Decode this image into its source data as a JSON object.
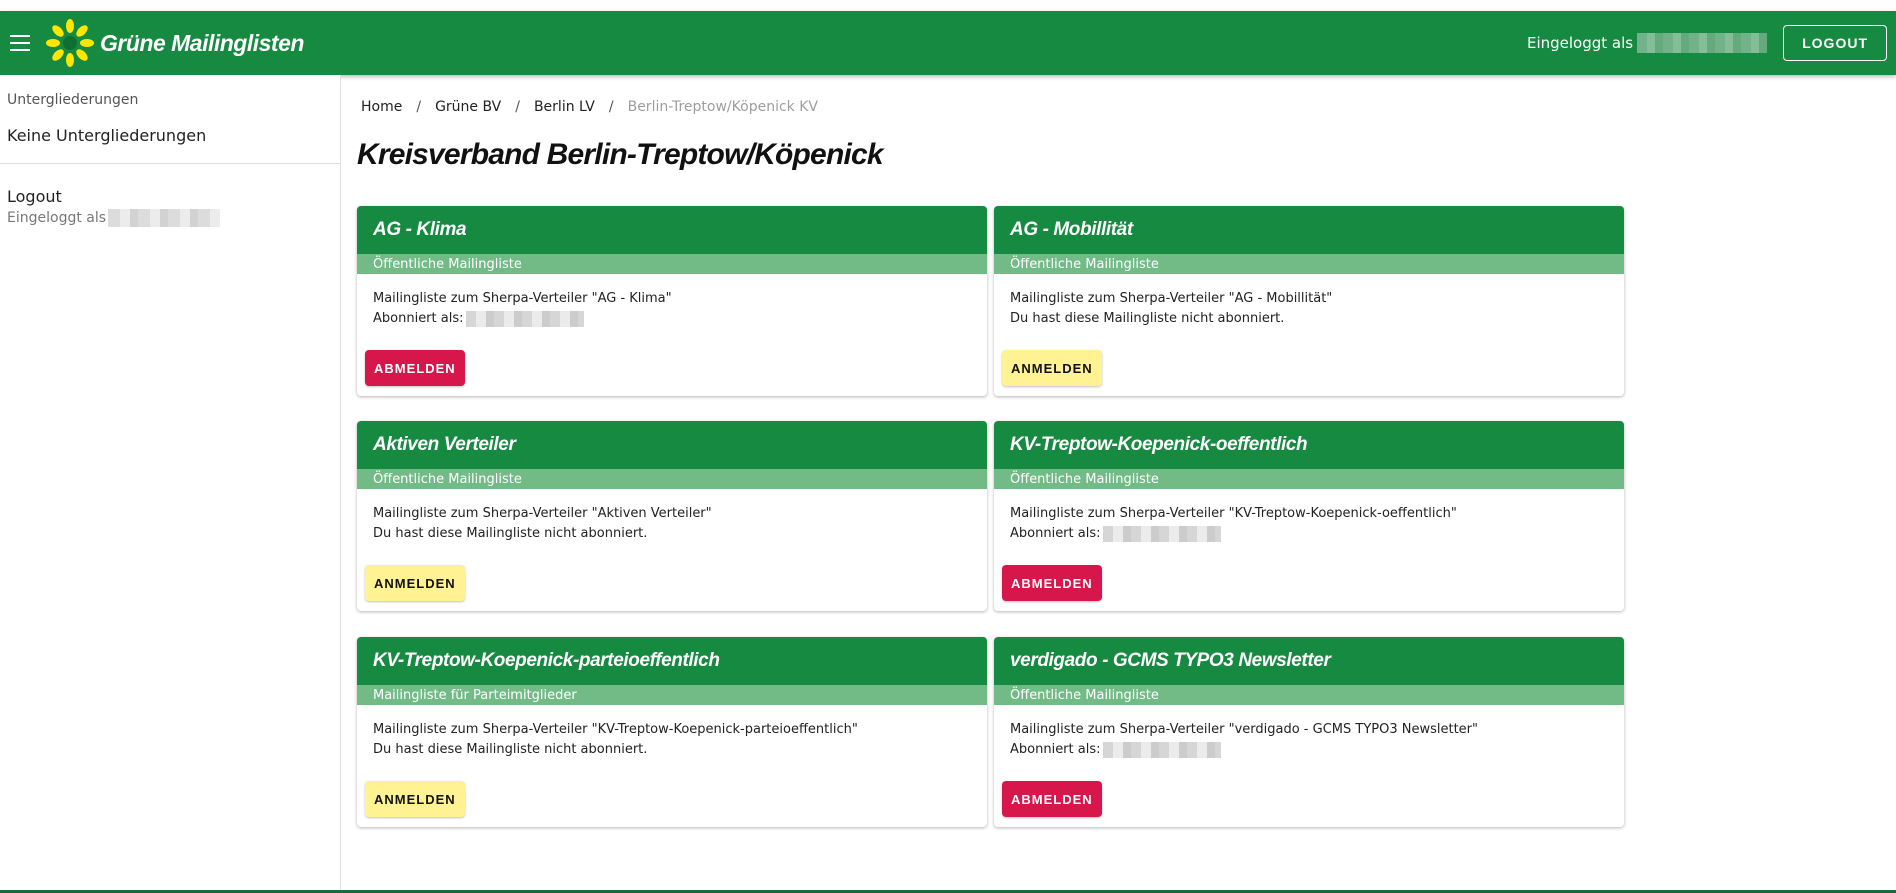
{
  "header": {
    "app_title": "Grüne Mailinglisten",
    "logged_in_label": "Eingeloggt als",
    "logout_label": "LOGOUT",
    "brand_color": "#178a41"
  },
  "sidebar": {
    "subheader": "Untergliederungen",
    "none_label": "Keine Untergliederungen",
    "logout_label": "Logout",
    "logged_in_label": "Eingeloggt als"
  },
  "breadcrumb": {
    "items": [
      "Home",
      "Grüne BV",
      "Berlin LV"
    ],
    "current": "Berlin-Treptow/Köpenick KV",
    "separator": "/"
  },
  "page_title": "Kreisverband Berlin-Treptow/Köpenick",
  "cards": [
    {
      "title": "AG - Klima",
      "type": "Öffentliche Mailingliste",
      "line1": "Mailingliste zum Sherpa-Verteiler \"AG - Klima\"",
      "line2": "Abonniert als:",
      "subscribed": true,
      "button": "ABMELDEN"
    },
    {
      "title": "AG - Mobillität",
      "type": "Öffentliche Mailingliste",
      "line1": "Mailingliste zum Sherpa-Verteiler \"AG - Mobillität\"",
      "line2": "Du hast diese Mailingliste nicht abonniert.",
      "subscribed": false,
      "button": "ANMELDEN"
    },
    {
      "title": "Aktiven Verteiler",
      "type": "Öffentliche Mailingliste",
      "line1": "Mailingliste zum Sherpa-Verteiler \"Aktiven Verteiler\"",
      "line2": "Du hast diese Mailingliste nicht abonniert.",
      "subscribed": false,
      "button": "ANMELDEN"
    },
    {
      "title": "KV-Treptow-Koepenick-oeffentlich",
      "type": "Öffentliche Mailingliste",
      "line1": "Mailingliste zum Sherpa-Verteiler \"KV-Treptow-Koepenick-oeffentlich\"",
      "line2": "Abonniert als:",
      "subscribed": true,
      "button": "ABMELDEN"
    },
    {
      "title": "KV-Treptow-Koepenick-parteioeffentlich",
      "type": "Mailingliste für Parteimitglieder",
      "line1": "Mailingliste zum Sherpa-Verteiler \"KV-Treptow-Koepenick-parteioeffentlich\"",
      "line2": "Du hast diese Mailingliste nicht abonniert.",
      "subscribed": false,
      "button": "ANMELDEN"
    },
    {
      "title": "verdigado - GCMS TYPO3 Newsletter",
      "type": "Öffentliche Mailingliste",
      "line1": "Mailingliste zum Sherpa-Verteiler \"verdigado - GCMS TYPO3 Newsletter\"",
      "line2": "Abonniert als:",
      "subscribed": true,
      "button": "ABMELDEN"
    }
  ]
}
